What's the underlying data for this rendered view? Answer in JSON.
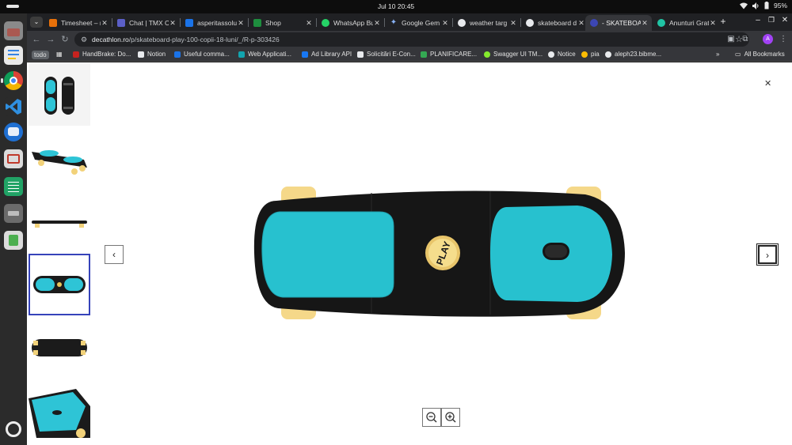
{
  "system": {
    "clock": "Jul 10  20:45",
    "battery": "95%"
  },
  "tabs": [
    {
      "title": "Timesheet – r",
      "favicon_color": "#e8710a"
    },
    {
      "title": "Chat | TMX Cl",
      "favicon_color": "#5b5fc7"
    },
    {
      "title": "asperitassolu",
      "favicon_color": "#1a73e8"
    },
    {
      "title": "Shop",
      "favicon_color": "#1e8e3e"
    },
    {
      "title": "WhatsApp Bu",
      "favicon_color": "#25d366"
    },
    {
      "title": "Google Gem",
      "favicon_color": "#8ab4f8"
    },
    {
      "title": "weather targ",
      "favicon_color": "#e8eaed"
    },
    {
      "title": "skateboard d",
      "favicon_color": "#e8eaed"
    },
    {
      "title": "- SKATEBOAR",
      "favicon_color": "#3c46b4"
    },
    {
      "title": "Anunturi Grat",
      "favicon_color": "#20c4a4"
    }
  ],
  "omnibox": {
    "domain": "decathlon.ro",
    "path": "/p/skateboard-play-100-copii-18-luni/_/R-p-303426"
  },
  "profile_initial": "A",
  "bookmarks": [
    {
      "label": "todo"
    },
    {
      "label": "HandBrake: Do...",
      "color": "#c5221f"
    },
    {
      "label": "Notion",
      "color": "#e8eaed"
    },
    {
      "label": "Useful comma...",
      "color": "#1a73e8"
    },
    {
      "label": "Web Applicati...",
      "color": "#12a4af"
    },
    {
      "label": "Ad Library API",
      "color": "#1877f2"
    },
    {
      "label": "Solicitări E-Con...",
      "color": "#e8eaed"
    },
    {
      "label": "PLANIFICARE...",
      "color": "#34a853"
    },
    {
      "label": "Swagger UI TM...",
      "color": "#85ea2d"
    },
    {
      "label": "Notice",
      "color": "#e8eaed"
    },
    {
      "label": "pia",
      "color": "#fbbc04"
    },
    {
      "label": "aleph23.bibme...",
      "color": "#e8eaed"
    }
  ],
  "all_bookmarks_label": "All Bookmarks",
  "gallery": {
    "selected_index": 3,
    "thumbnail_count": 6
  },
  "product_logo_text": "PLAY"
}
